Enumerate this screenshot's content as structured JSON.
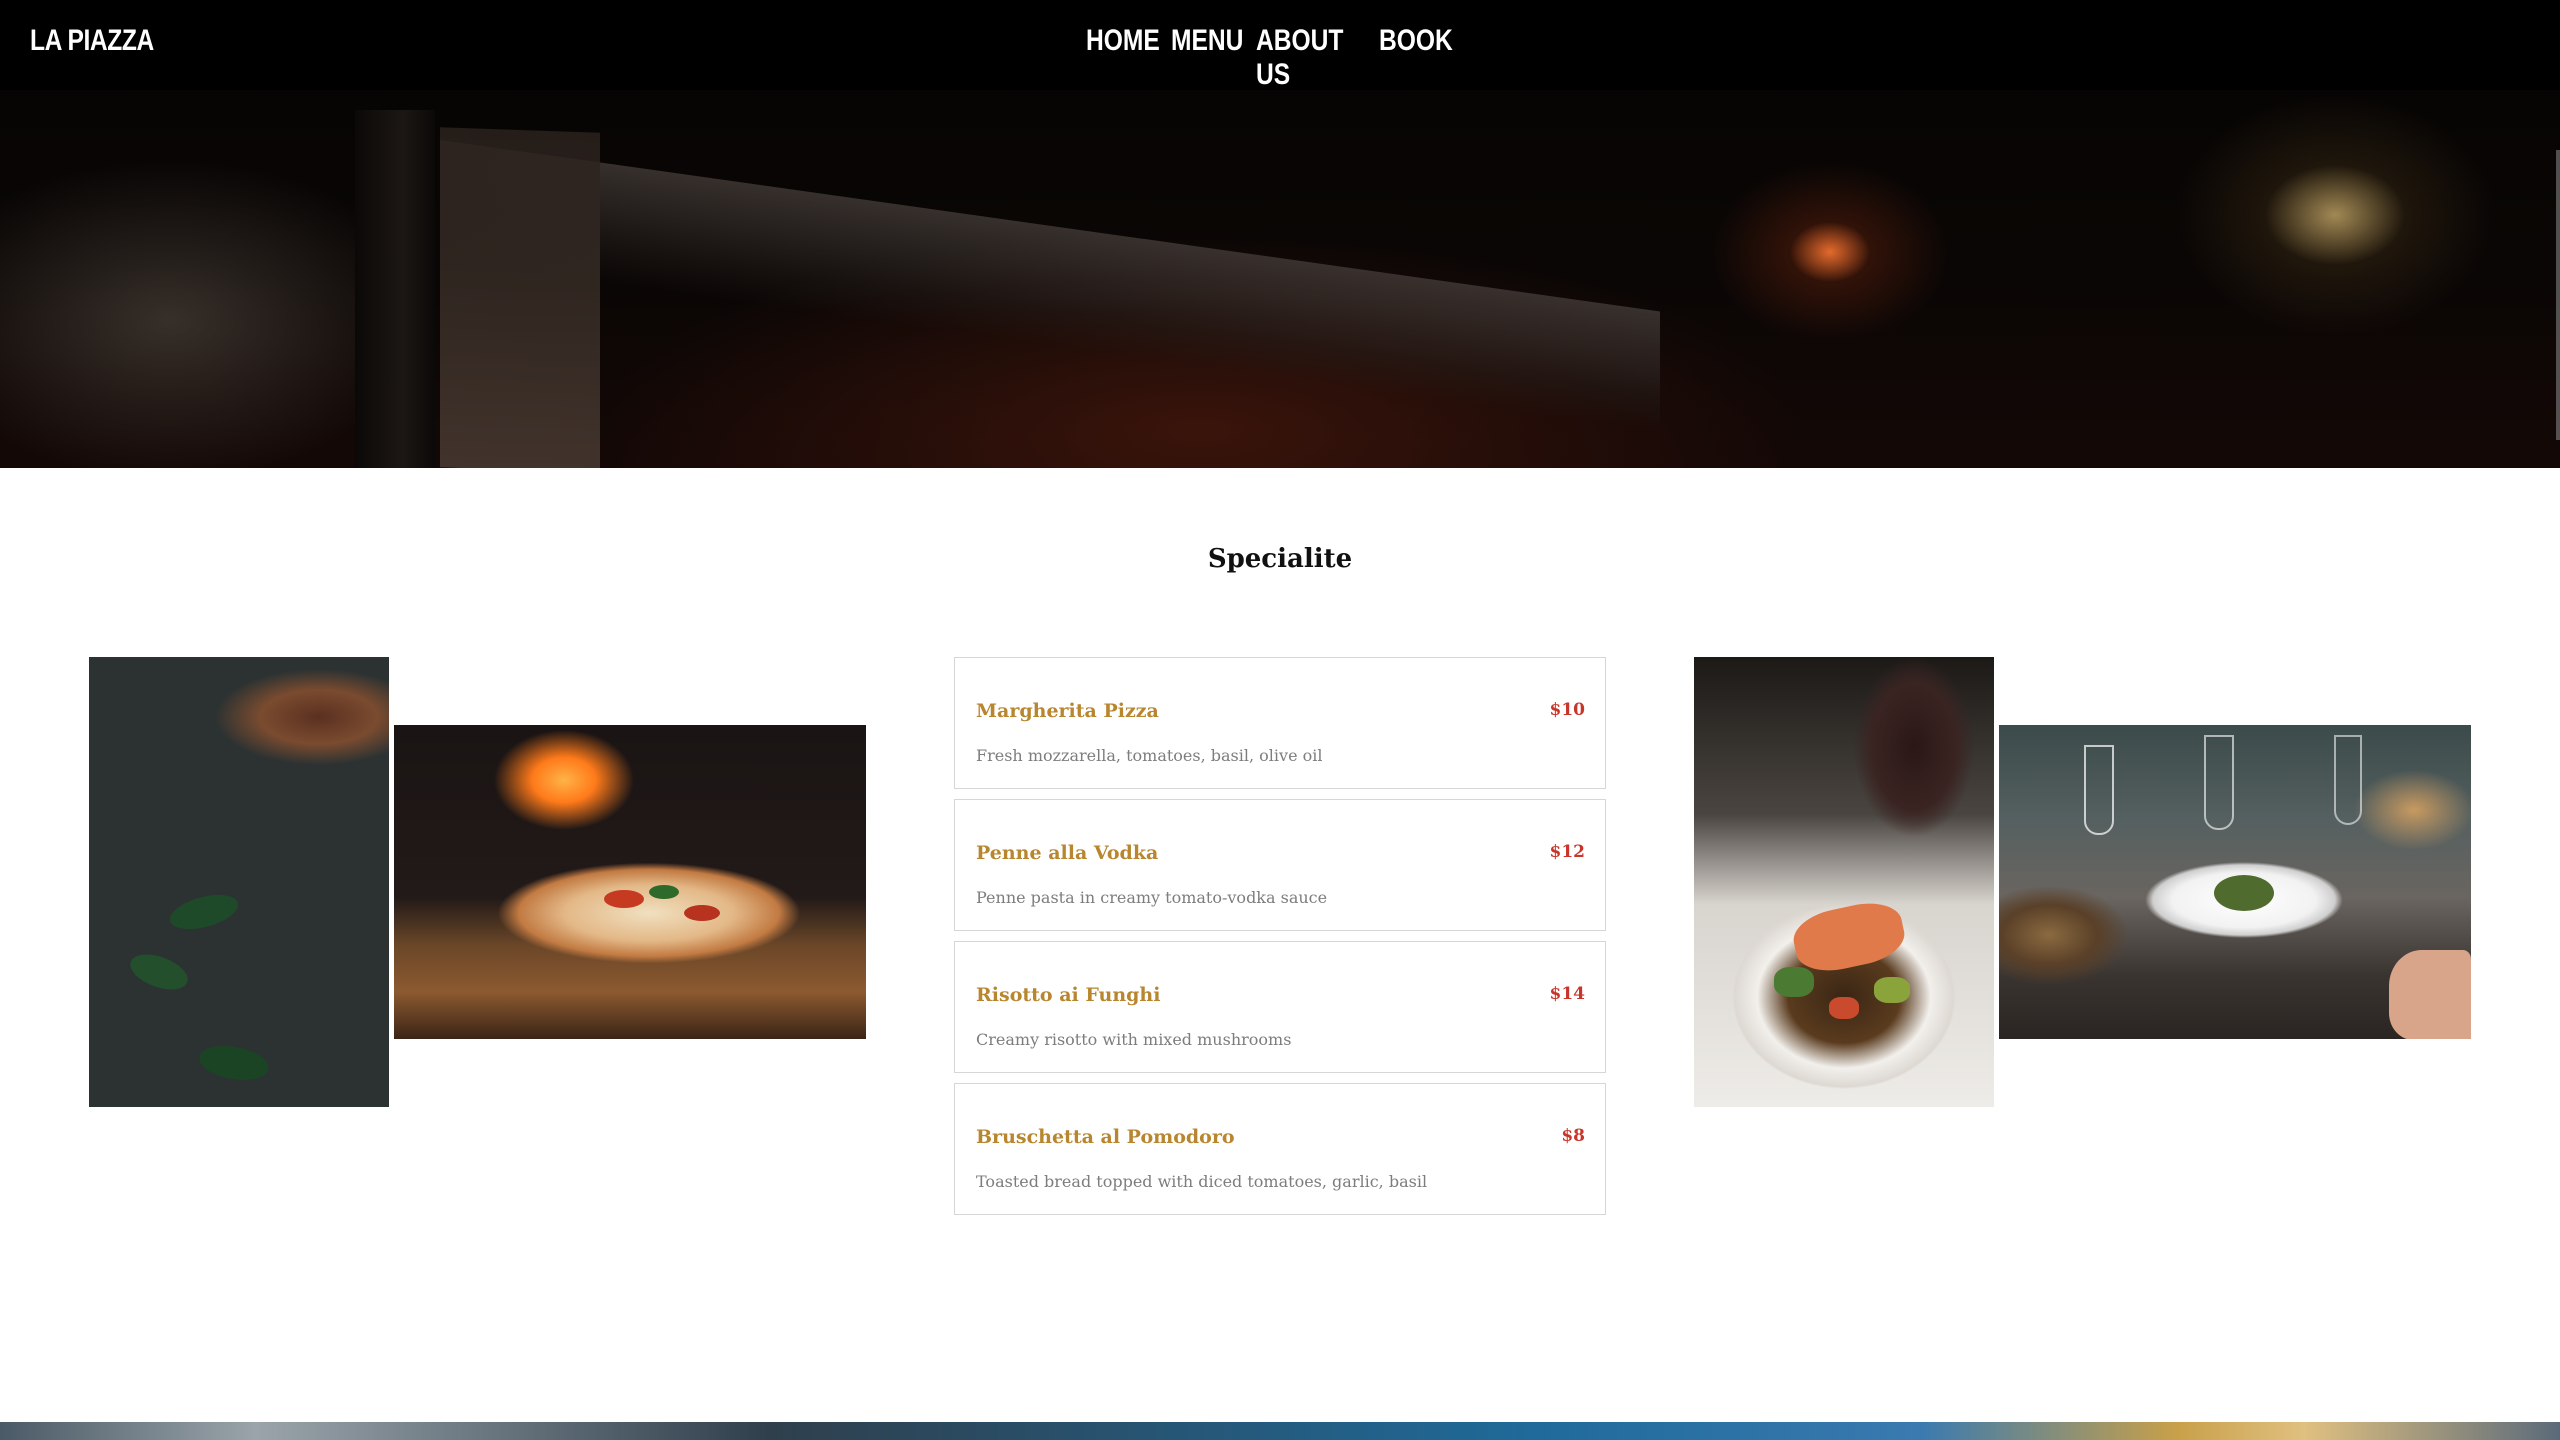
{
  "brand": "LA PIAZZA",
  "nav": {
    "home": "HOME",
    "menu": "MENU",
    "about": "ABOUT US",
    "book": "BOOK"
  },
  "section": {
    "title": "Specialite"
  },
  "menu_items": [
    {
      "name": "Margherita Pizza",
      "price": "$10",
      "description": "Fresh mozzarella, tomatoes, basil, olive oil"
    },
    {
      "name": "Penne alla Vodka",
      "price": "$12",
      "description": "Penne pasta in creamy tomato-vodka sauce"
    },
    {
      "name": "Risotto ai Funghi",
      "price": "$14",
      "description": "Creamy risotto with mixed mushrooms"
    },
    {
      "name": "Bruschetta al Pomodoro",
      "price": "$8",
      "description": "Toasted bread topped with diced tomatoes, garlic, basil"
    }
  ],
  "colors": {
    "nav_background": "#000000",
    "dish_name": "#b8862e",
    "price": "#c8352a",
    "description": "#7d7d7d"
  }
}
